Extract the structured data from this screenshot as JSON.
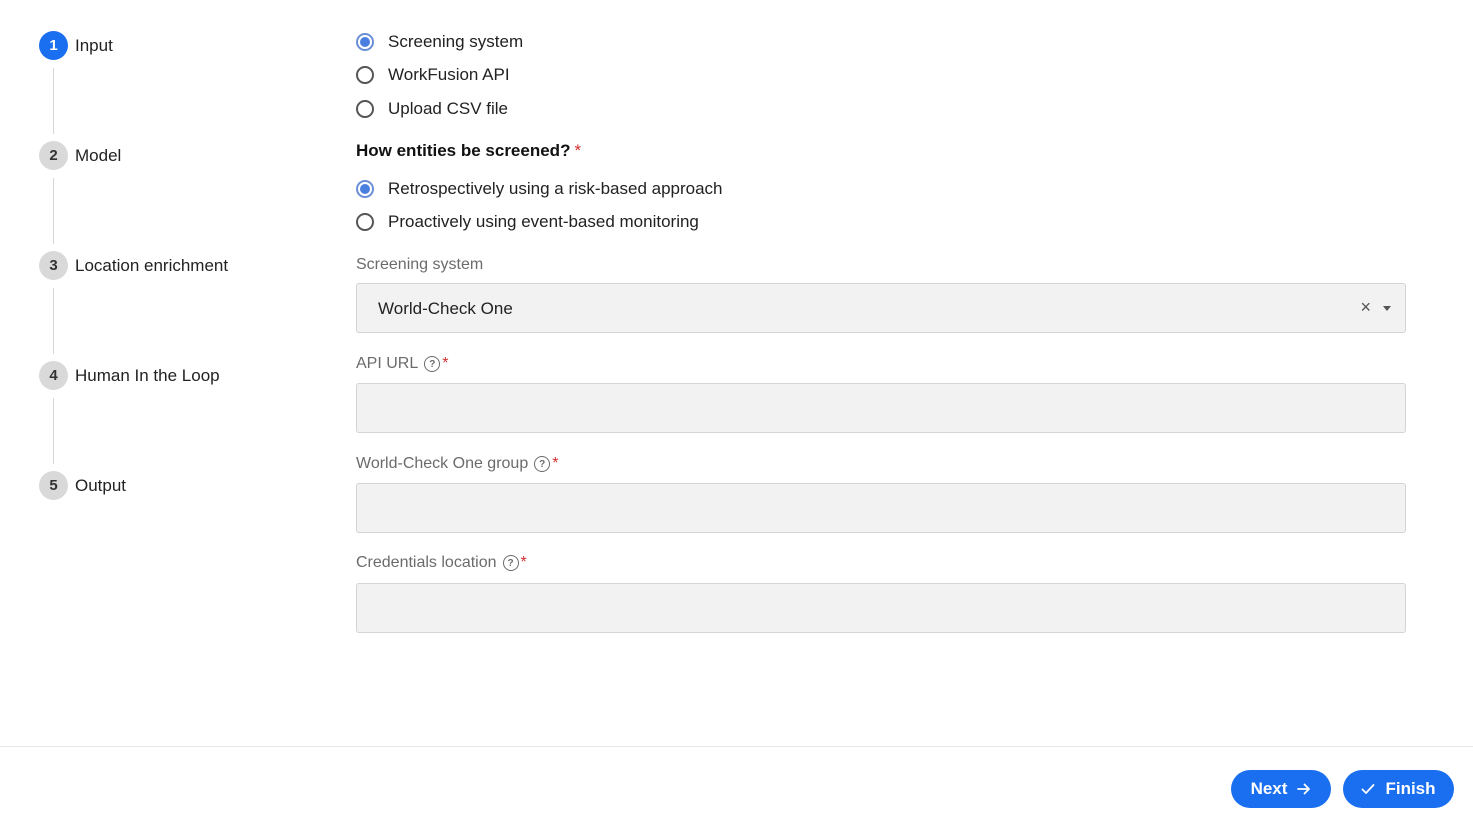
{
  "stepper": {
    "steps": [
      {
        "number": "1",
        "label": "Input",
        "active": true
      },
      {
        "number": "2",
        "label": "Model",
        "active": false
      },
      {
        "number": "3",
        "label": "Location enrichment",
        "active": false
      },
      {
        "number": "4",
        "label": "Human In the Loop",
        "active": false
      },
      {
        "number": "5",
        "label": "Output",
        "active": false
      }
    ]
  },
  "input_source": {
    "options": [
      {
        "label": "Screening system",
        "checked": true
      },
      {
        "label": "WorkFusion API",
        "checked": false
      },
      {
        "label": "Upload CSV file",
        "checked": false
      }
    ]
  },
  "screening_question": {
    "label": "How entities be screened?",
    "required_mark": "*",
    "options": [
      {
        "label": "Retrospectively using a risk-based approach",
        "checked": true
      },
      {
        "label": "Proactively using event-based monitoring",
        "checked": false
      }
    ]
  },
  "screening_system": {
    "label": "Screening system",
    "value": "World-Check One",
    "clear_glyph": "×"
  },
  "api_url": {
    "label": "API URL",
    "help_glyph": "?",
    "required_mark": "*",
    "value": ""
  },
  "wco_group": {
    "label": "World-Check One group",
    "help_glyph": "?",
    "required_mark": "*",
    "value": ""
  },
  "credentials": {
    "label": "Credentials location",
    "help_glyph": "?",
    "required_mark": "*",
    "value": ""
  },
  "footer": {
    "next_label": "Next",
    "finish_label": "Finish"
  },
  "colors": {
    "primary": "#1a6ef0",
    "required": "#d23030",
    "input_bg": "#f2f2f2"
  }
}
